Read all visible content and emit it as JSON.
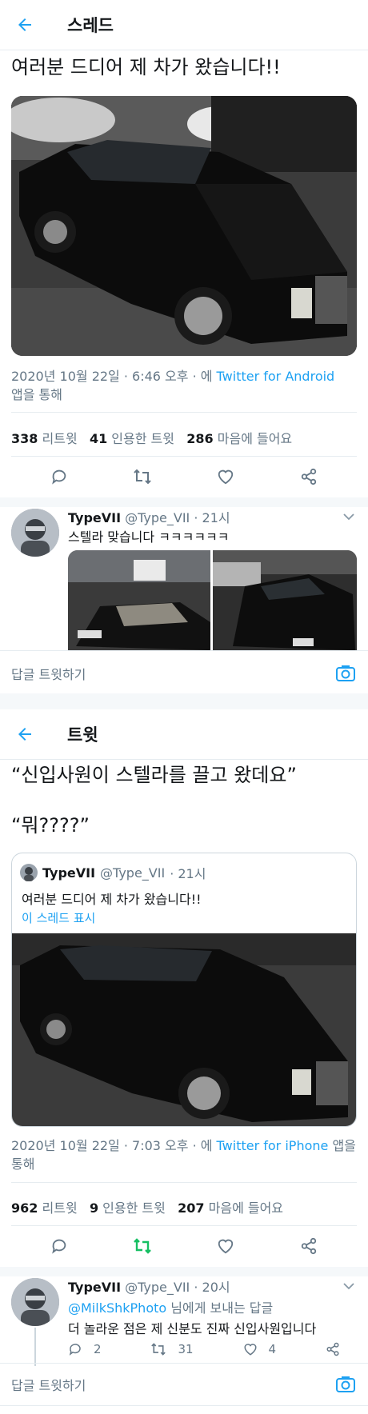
{
  "thread_header": {
    "back_icon": "arrow-left-icon",
    "title": "스레드"
  },
  "main_tweet": {
    "text": "여러분 드디어 제 차가 왔습니다!!",
    "meta_prefix": "2020년 10월 22일 · 6:46 오후 · 에 ",
    "client": "Twitter for Android",
    "meta_suffix": "앱을 통해",
    "retweets": "338",
    "retweets_label": "리트윗",
    "quotes": "41",
    "quotes_label": "인용한 트윗",
    "likes": "286",
    "likes_label": "마음에 들어요"
  },
  "reply1": {
    "name": "TypeVII",
    "handle": "@Type_VII",
    "time": "· 21시",
    "text": "스텔라 맞습니다 ㅋㅋㅋㅋㅋㅋ"
  },
  "reply_bar1": {
    "label": "답글 트윗하기",
    "camera_icon": "camera-icon"
  },
  "tweet_header": {
    "back_icon": "arrow-left-icon",
    "title": "트윗"
  },
  "second_tweet": {
    "line1": "“신입사원이 스텔라를 끌고 왔데요”",
    "line2": "“뭐????”",
    "quoted": {
      "name": "TypeVII",
      "handle": "@Type_VII",
      "time": "· 21시",
      "text": "여러분 드디어 제 차가 왔습니다!!",
      "show_thread": "이 스레드 표시"
    },
    "meta_prefix": "2020년 10월 22일 · 7:03 오후 · 에 ",
    "client": "Twitter for iPhone",
    "meta_suffix": " 앱을 통해",
    "retweets": "962",
    "retweets_label": "리트윗",
    "quotes": "9",
    "quotes_label": "인용한 트윗",
    "likes": "207",
    "likes_label": "마음에 들어요"
  },
  "reply2": {
    "name": "TypeVII",
    "handle": "@Type_VII",
    "time": "· 20시",
    "mention": "@MilkShkPhoto",
    "mention_suffix": " 님에게 보내는 답글",
    "text": "더 놀라운 점은 제 신분도 진짜 신입사원입니다",
    "reply_count": "2",
    "retweet_count": "31",
    "like_count": "4"
  },
  "reply_bar2": {
    "label": "답글 트윗하기",
    "camera_icon": "camera-icon"
  },
  "colors": {
    "accent": "#1da1f2",
    "retweeted": "#17bf63",
    "muted": "#657786"
  }
}
